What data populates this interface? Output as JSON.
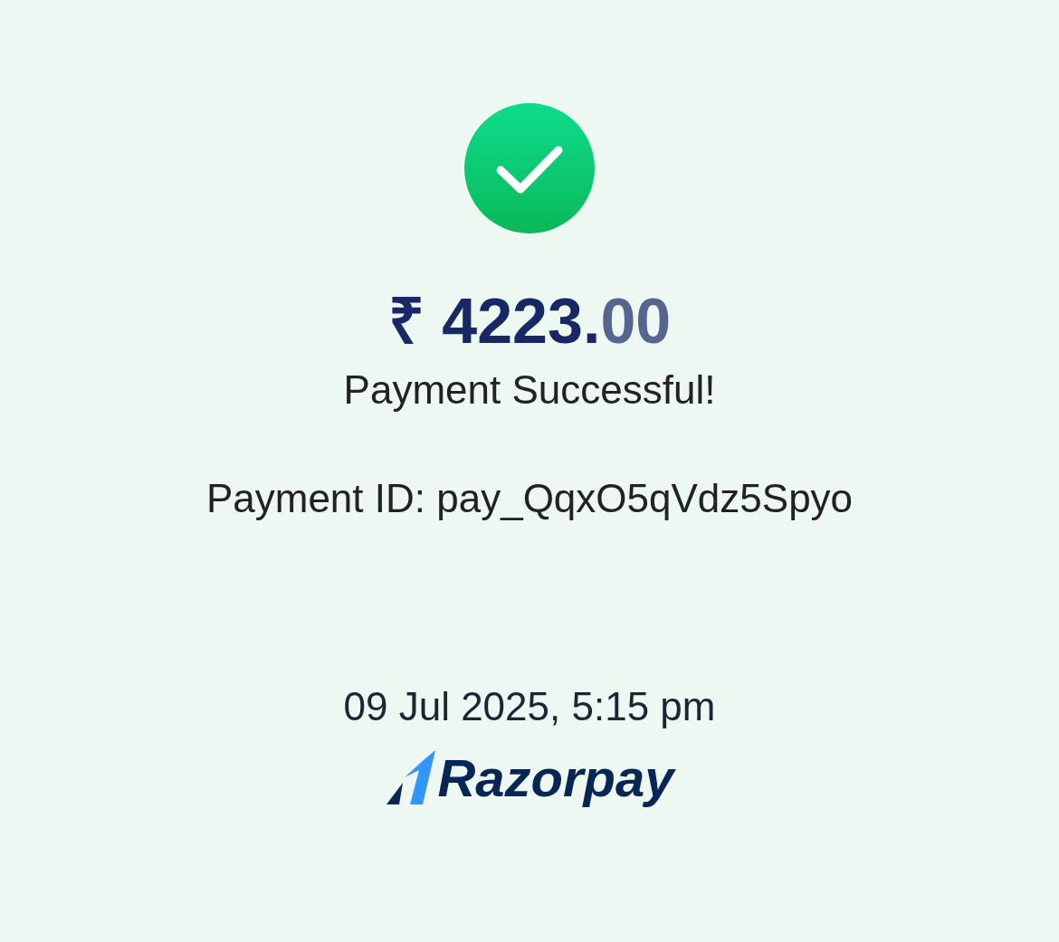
{
  "status": {
    "kind": "success"
  },
  "amount": {
    "main": "₹ 4223.",
    "fraction": "00"
  },
  "message": "Payment Successful!",
  "payment_id": "Payment ID: pay_QqxO5qVdz5Spyo",
  "timestamp": "09 Jul 2025, 5:15 pm",
  "brand": "Razorpay"
}
